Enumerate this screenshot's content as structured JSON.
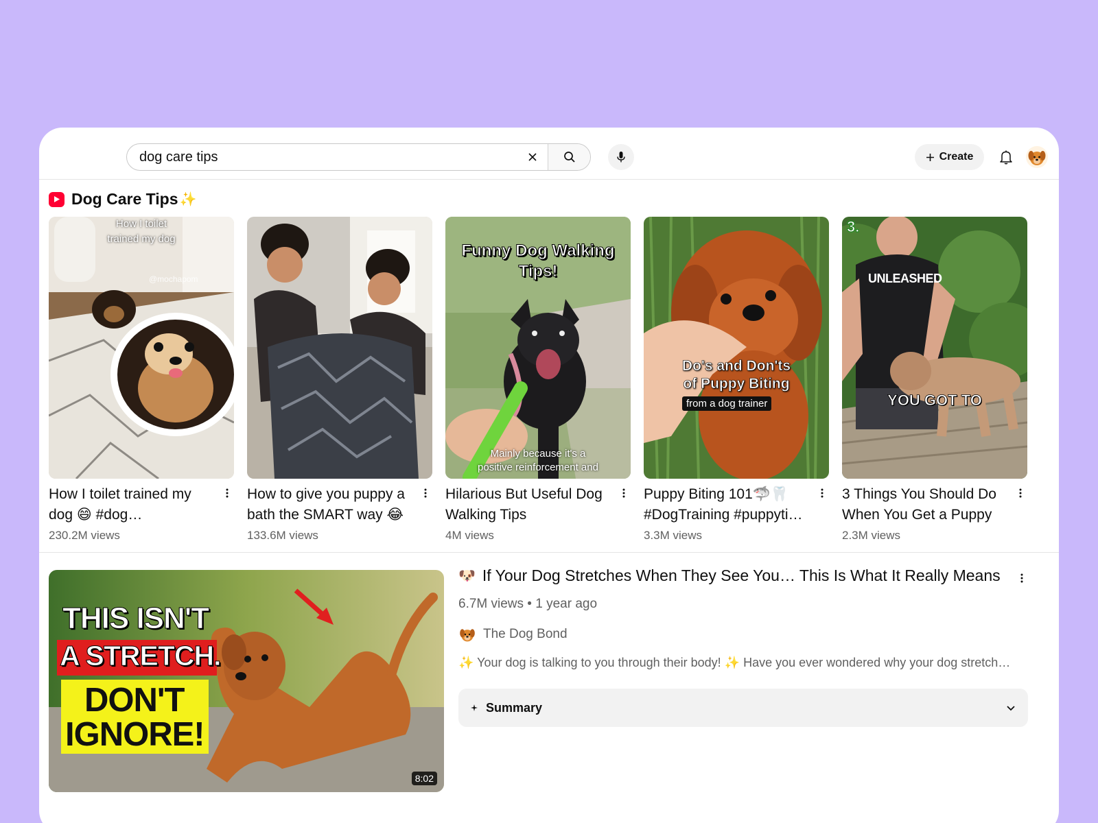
{
  "search": {
    "query": "dog care tips"
  },
  "header": {
    "create_label": "Create"
  },
  "shelf": {
    "title": "Dog Care Tips",
    "sparkle": "✨",
    "shorts": [
      {
        "title": "How I toilet trained my dog 😄  #dog…",
        "views": "230.2M views",
        "overlay_lines": [
          "How I toilet",
          "trained my dog"
        ],
        "overlay_handle": "@mochapom"
      },
      {
        "title": "How to give you puppy a bath the SMART way 😂",
        "views": "133.6M views"
      },
      {
        "title": "Hilarious But Useful Dog Walking Tips",
        "views": "4M views",
        "overlay_lines": [
          "Funny Dog Walking",
          "Tips!"
        ],
        "overlay_caption": [
          "Mainly because it's a",
          "positive reinforcement and"
        ]
      },
      {
        "title": "Puppy Biting 101🦈🦷 #DogTraining #puppyti…",
        "views": "3.3M views",
        "overlay_lines": [
          "Do's and Don'ts",
          "of Puppy Biting"
        ],
        "overlay_badge": "from a dog trainer"
      },
      {
        "title": "3 Things You Should Do When You Get a Puppy",
        "views": "2.3M views",
        "overlay_number": "3.",
        "overlay_shirt": "UNLEASHED",
        "overlay_caption": "YOU GOT TO"
      }
    ]
  },
  "video": {
    "title": "If Your Dog Stretches When They See You… This Is What It Really Means",
    "title_emoji": "🐶",
    "meta": "6.7M views • 1 year ago",
    "channel": "The Dog Bond",
    "description": "✨ Your dog is talking to you through their body! ✨ Have you ever wondered why your dog stretch…",
    "duration": "8:02",
    "thumb_text": {
      "line1": "THIS ISN'T",
      "line2": "A STRETCH.",
      "line3": "DON'T",
      "line4": "IGNORE!"
    },
    "summary_label": "Summary"
  },
  "colors": {
    "background": "#c9b8fb",
    "shorts_red": "#ff0033",
    "meta_gray": "#606060"
  }
}
